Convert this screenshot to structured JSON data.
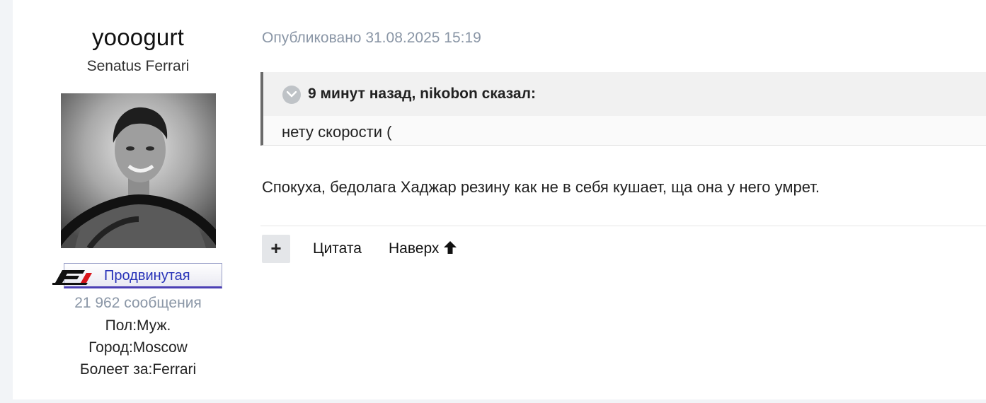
{
  "author": {
    "username": "yooogurt",
    "group": "Senatus Ferrari",
    "rank_label": "Продвинутая",
    "post_count": "21 962 сообщения",
    "fields": [
      "Пол:Муж.",
      "Город:Moscow",
      "Болеет за:Ferrari"
    ]
  },
  "post": {
    "published": "Опубликовано 31.08.2025 15:19",
    "quote": {
      "citation": "9 минут назад, nikobon сказал:",
      "text": "нету скорости ("
    },
    "text": "Спокуха, бедолага Хаджар резину как не в себя кушает, ща она у него умрет."
  },
  "actions": {
    "plus_label": "+",
    "quote_label": "Цитата",
    "top_label": "Наверх"
  },
  "colors": {
    "meta_text": "#8a96a6",
    "rank_text": "#2732b8",
    "quote_border": "#6a6a6a"
  }
}
